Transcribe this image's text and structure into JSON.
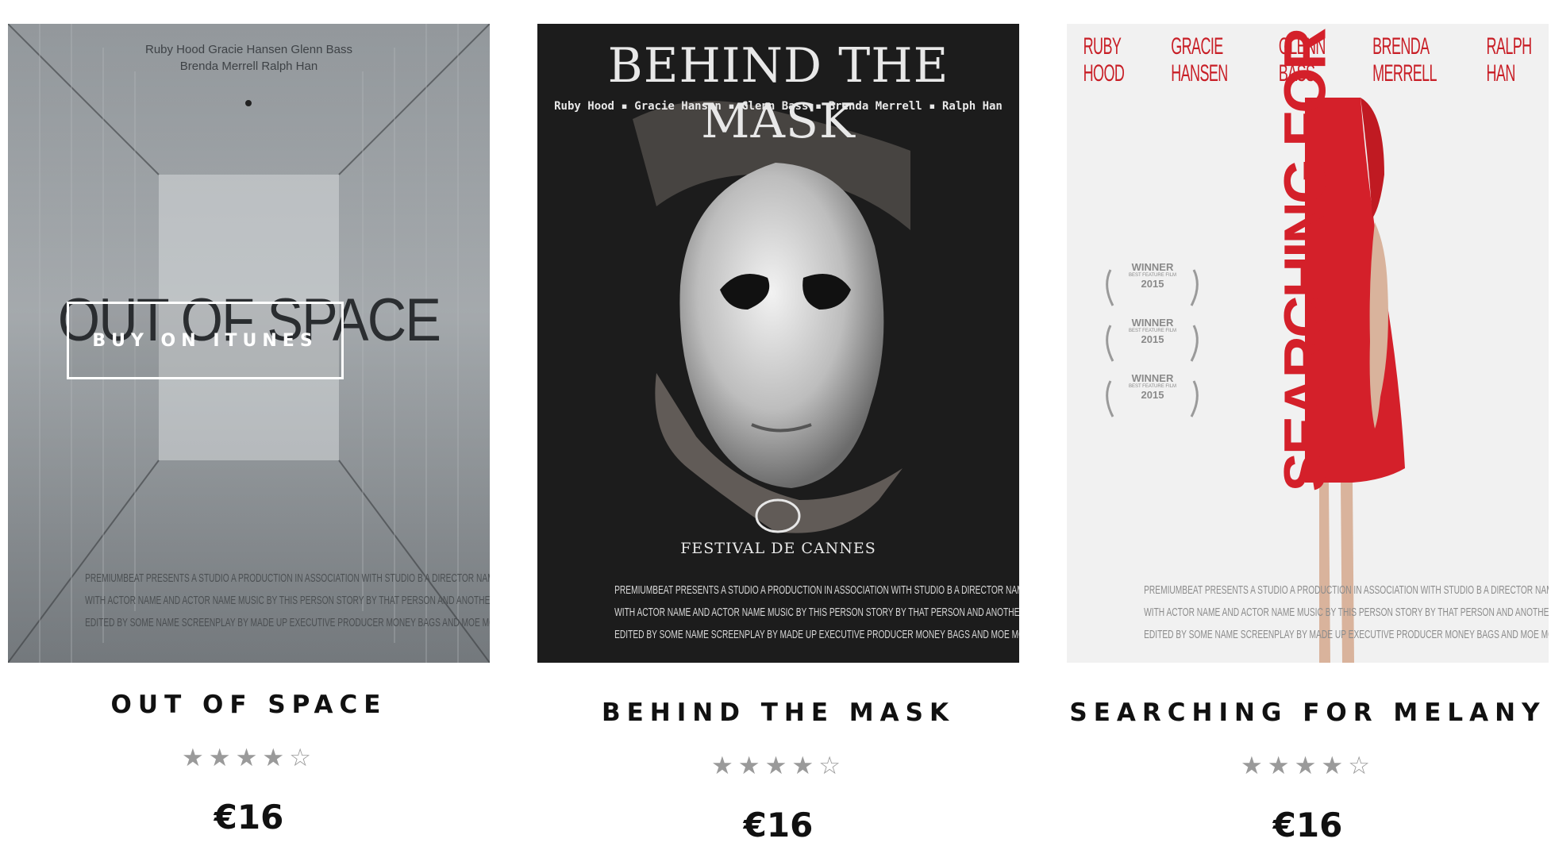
{
  "products": [
    {
      "title": "OUT OF SPACE",
      "price": "€16",
      "rating": 4,
      "rating_max": 5,
      "poster": {
        "title": "OUT OF SPACE",
        "cast_line1": "Ruby Hood  Gracie Hansen  Glenn Bass",
        "cast_line2": "Brenda Merrell  Ralph Han",
        "credits": [
          "PREMIUMBEAT PRESENTS A STUDIO A PRODUCTION IN ASSOCIATION WITH STUDIO B A DIRECTOR NAME FILM ACTOR NAME ACTOR NAME MOVIE TITLE",
          "WITH ACTOR NAME AND ACTOR NAME MUSIC BY THIS PERSON STORY BY THAT PERSON AND ANOTHER PERSON",
          "EDITED BY SOME NAME SCREENPLAY BY MADE UP EXECUTIVE PRODUCER MONEY BAGS AND MOE MONEY DIRECTED BY DIRECTOR NAME"
        ]
      },
      "overlay_button": "BUY ON ITUNES"
    },
    {
      "title": "BEHIND THE MASK",
      "price": "€16",
      "rating": 4,
      "rating_max": 5,
      "poster": {
        "title": "BEHIND THE MASK",
        "cast_line": "Ruby Hood ▪ Gracie Hansen ▪ Glenn Bass ▪ Brenda Merrell ▪ Ralph Han",
        "festival": "FESTIVAL DE CANNES",
        "credits": [
          "PREMIUMBEAT PRESENTS A STUDIO A PRODUCTION IN ASSOCIATION WITH STUDIO B A DIRECTOR NAME FILM ACTOR NAME ACTOR NAME MOVIE TITLE",
          "WITH ACTOR NAME AND ACTOR NAME MUSIC BY THIS PERSON STORY BY THAT PERSON AND ANOTHER PERSON",
          "EDITED BY SOME NAME SCREENPLAY BY MADE UP EXECUTIVE PRODUCER MONEY BAGS AND MOE MONEY DIRECTED BY DIRECTOR NAME"
        ]
      }
    },
    {
      "title": "SEARCHING FOR MELANY",
      "price": "€16",
      "rating": 4,
      "rating_max": 5,
      "poster": {
        "title": "SEARCHING FOR MELANY",
        "cast": [
          "RUBY HOOD",
          "GRACIE HANSEN",
          "GLENN BASS",
          "BRENDA MERRELL",
          "RALPH HAN"
        ],
        "laurel_text": "WINNER",
        "laurel_sub": "BEST FEATURE FILM",
        "laurel_year": "2015",
        "credits": [
          "PREMIUMBEAT PRESENTS A STUDIO A PRODUCTION IN ASSOCIATION WITH STUDIO B A DIRECTOR NAME FILM ACTOR NAME ACTOR NAME MOVIE TITLE",
          "WITH ACTOR NAME AND ACTOR NAME MUSIC BY THIS PERSON STORY BY THAT PERSON AND ANOTHER PERSON",
          "EDITED BY SOME NAME SCREENPLAY BY MADE UP EXECUTIVE PRODUCER MONEY BAGS AND MOE MONEY DIRECTED BY DIRECTOR NAME"
        ]
      }
    }
  ],
  "colors": {
    "poster1_bg": "#7d8185",
    "poster2_bg": "#1c1c1c",
    "poster3_bg": "#f1f1f1",
    "poster3_accent": "#d4202a",
    "star": "#9a9a9a",
    "text": "#111111"
  },
  "icons": {
    "star_full": "star-icon",
    "star_empty": "star-outline-icon"
  }
}
